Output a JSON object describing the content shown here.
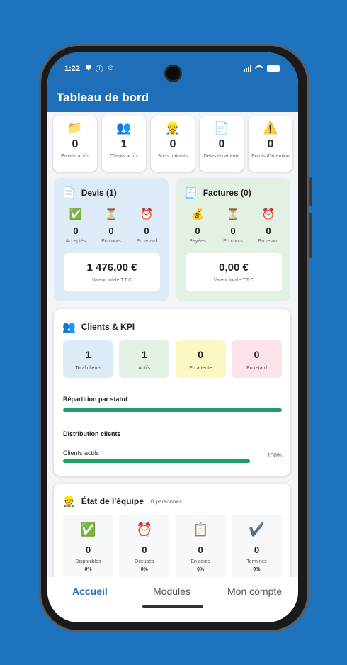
{
  "status": {
    "time": "1:22",
    "left_icons": "⛊ ⓘ ⊘"
  },
  "appbar": {
    "title": "Tableau de bord"
  },
  "stats": [
    {
      "icon": "folder-icon",
      "glyph": "📁",
      "value": "0",
      "label": "Projets actifs"
    },
    {
      "icon": "people-icon",
      "glyph": "👥",
      "value": "1",
      "label": "Clients actifs"
    },
    {
      "icon": "worker-icon",
      "glyph": "👷",
      "value": "0",
      "label": "Sous traitants"
    },
    {
      "icon": "document-icon",
      "glyph": "📄",
      "value": "0",
      "label": "Devis en attente"
    },
    {
      "icon": "warning-icon",
      "glyph": "⚠️",
      "value": "0",
      "label": "Points d'attention"
    }
  ],
  "devis": {
    "title": "Devis (1)",
    "items": [
      {
        "icon": "check-icon",
        "glyph": "✅",
        "value": "0",
        "label": "Acceptés"
      },
      {
        "icon": "hourglass-icon",
        "glyph": "⏳",
        "value": "0",
        "label": "En cours"
      },
      {
        "icon": "alarm-icon",
        "glyph": "⏰",
        "value": "0",
        "label": "En retard"
      }
    ],
    "total_amount": "1 476,00 €",
    "total_label": "Valeur totale T.T.C"
  },
  "factures": {
    "title": "Factures (0)",
    "items": [
      {
        "icon": "money-bag-icon",
        "glyph": "💰",
        "value": "0",
        "label": "Payées"
      },
      {
        "icon": "hourglass-icon",
        "glyph": "⏳",
        "value": "0",
        "label": "En cours"
      },
      {
        "icon": "alarm-icon",
        "glyph": "⏰",
        "value": "0",
        "label": "En retard"
      }
    ],
    "total_amount": "0,00 €",
    "total_label": "Valeur totale T.T.C"
  },
  "kpi": {
    "title": "Clients & KPI",
    "items": [
      {
        "value": "1",
        "label": "Total clients",
        "color": "#dcebf8"
      },
      {
        "value": "1",
        "label": "Actifs",
        "color": "#e3f1e4"
      },
      {
        "value": "0",
        "label": "En attente",
        "color": "#fbf7c0"
      },
      {
        "value": "0",
        "label": "En retard",
        "color": "#fbe3e8"
      }
    ],
    "repartition_label": "Répartition par statut",
    "repartition_fraction": 1.0,
    "distribution_label": "Distribution clients",
    "actifs_label": "Clients actifs",
    "actifs_pct": "100%",
    "actifs_fraction": 1.0,
    "bar_color": "#1f9d6b"
  },
  "team": {
    "title": "État de l'équipe",
    "subtitle": "0 personnes",
    "items": [
      {
        "icon": "check-icon",
        "glyph": "✅",
        "value": "0",
        "label": "Disponibles",
        "pct": "0%"
      },
      {
        "icon": "alarm-icon",
        "glyph": "⏰",
        "value": "0",
        "label": "Occupés",
        "pct": "0%"
      },
      {
        "icon": "clipboard-icon",
        "glyph": "📋",
        "value": "0",
        "label": "En cours",
        "pct": "0%"
      },
      {
        "icon": "checkmark-icon",
        "glyph": "✔️",
        "value": "0",
        "label": "Terminés",
        "pct": "0%"
      }
    ]
  },
  "nav": {
    "home": "Accueil",
    "modules": "Modules",
    "account": "Mon compte"
  },
  "colors": {
    "primary": "#1f6fb8",
    "background": "#1e73be"
  }
}
